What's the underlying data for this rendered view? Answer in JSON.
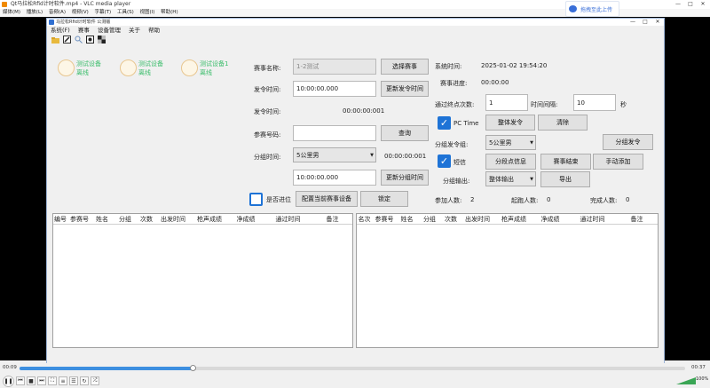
{
  "vlc": {
    "title": "Qt马拉松Rfid计时软件.mp4 - VLC media player",
    "menu": [
      "媒体(M)",
      "播放(L)",
      "音频(A)",
      "视频(V)",
      "字幕(T)",
      "工具(S)",
      "视图(I)",
      "帮助(H)"
    ],
    "window_controls": [
      "—",
      "□",
      "✕"
    ],
    "time_elapsed": "00:09",
    "time_total": "00:37",
    "progress": 0.26,
    "volume_percent": "100%"
  },
  "badge": {
    "label": "拖拽至此上传"
  },
  "app": {
    "title": "马拉松Rfid计时软件 公测版",
    "menu": [
      "系统(F)",
      "赛事",
      "设备管理",
      "关于",
      "帮助"
    ],
    "devices": [
      {
        "line1": "测试设备",
        "line2": "离线"
      },
      {
        "line1": "测试设备",
        "line2": "离线"
      },
      {
        "line1": "测试设备1",
        "line2": "离线"
      }
    ],
    "form": {
      "event_name_label": "赛事名称:",
      "event_name_value": "1-2测试",
      "select_event_button": "选择赛事",
      "start_time_label": "发令时间:",
      "start_time_value": "10:00:00.000",
      "update_start_time_button": "更新发令时间",
      "start_time_label2": "发令时间:",
      "start_time_display": "00:00:00:001",
      "bib_label": "参赛号码:",
      "bib_value": "",
      "query_button": "查询",
      "group_time_label": "分组时间:",
      "group_select": "5公里男",
      "group_time_display": "00:00:00:001",
      "group_time_value": "10:00:00.000",
      "update_group_time_button": "更新分组时间",
      "entered_checkbox_label": "是否进位",
      "config_device_button": "配置当前赛事设备",
      "lock_button": "锁定"
    },
    "right": {
      "sys_time_label": "系统时间:",
      "sys_time_value": "2025-01-02 19:54:20",
      "progress_label": "赛事进度:",
      "progress_value": "00:00:00",
      "pass_count_label": "通过终点次数:",
      "pass_count_value": "1",
      "interval_label": "时间间隔:",
      "interval_value": "10",
      "interval_unit": "秒",
      "pc_time_label": "PC Time",
      "overall_start_button": "整体发令",
      "clear_button": "清除",
      "group_start_label": "分组发令组:",
      "group_start_select": "5公里男",
      "group_start_button": "分组发令",
      "sms_label": "短信",
      "split_info_button": "分段点信息",
      "event_end_button": "赛事结束",
      "manual_add_button": "手动添加",
      "group_output_label": "分组输出:",
      "output_select": "整体输出",
      "export_button": "导出",
      "participants_label": "参加人数:",
      "participants_value": "2",
      "started_label": "起跑人数:",
      "started_value": "0",
      "finished_label": "完成人数:",
      "finished_value": "0"
    },
    "left_table_headers": [
      "编号",
      "参赛号",
      "姓名",
      "分组",
      "次数",
      "出发时间",
      "枪声成绩",
      "净成绩",
      "通过时间",
      "备注"
    ],
    "right_table_headers": [
      "名次",
      "参赛号",
      "姓名",
      "分组",
      "次数",
      "出发时间",
      "枪声成绩",
      "净成绩",
      "通过时间",
      "备注"
    ]
  }
}
